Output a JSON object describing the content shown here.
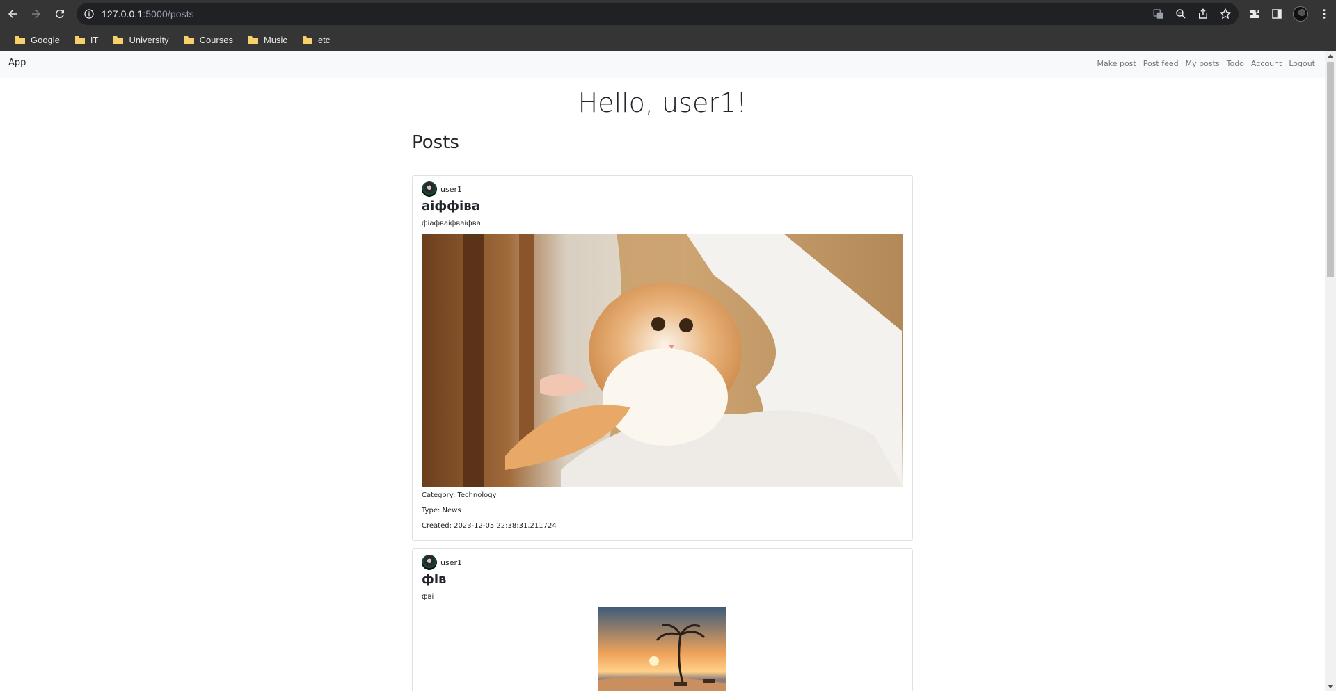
{
  "browser": {
    "url_host": "127.0.0.1",
    "url_path": ":5000/posts",
    "bookmarks": [
      {
        "label": "Google"
      },
      {
        "label": "IT"
      },
      {
        "label": "University"
      },
      {
        "label": "Courses"
      },
      {
        "label": "Music"
      },
      {
        "label": "etc"
      }
    ]
  },
  "navbar": {
    "brand": "App",
    "links": [
      "Make post",
      "Post feed",
      "My posts",
      "Todo",
      "Account",
      "Logout"
    ]
  },
  "greeting": "Hello, user1!",
  "posts_heading": "Posts",
  "posts": [
    {
      "author": "user1",
      "title": "аіффіва",
      "body": "фіафваіфваіфва",
      "category": "Category: Technology",
      "type": "Type: News",
      "created": "Created: 2023-12-05 22:38:31.211724"
    },
    {
      "author": "user1",
      "title": "фів",
      "body": "фві"
    }
  ]
}
